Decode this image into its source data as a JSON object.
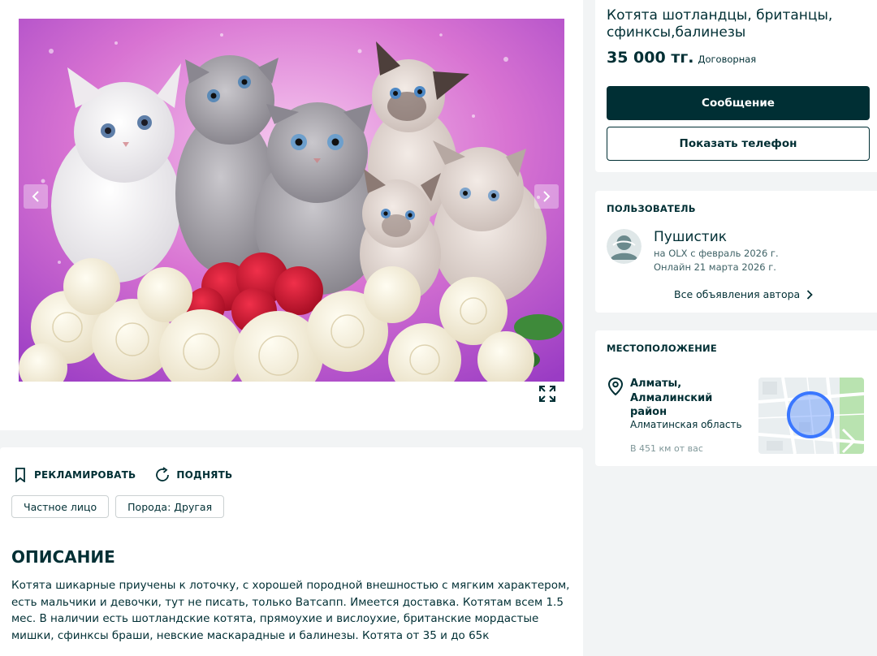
{
  "gallery": {
    "photo_alt": "",
    "prev_label": "",
    "next_label": ""
  },
  "actions": {
    "promote_label": "РЕКЛАМИРОВАТЬ",
    "raise_label": "ПОДНЯТЬ"
  },
  "tags": [
    "Частное лицо",
    "Порода: Другая"
  ],
  "description": {
    "title": "ОПИСАНИЕ",
    "text": "Котята шикарные приучены к лоточку, с хорошей породной внешностью с мягким характером, есть мальчики и девочки, тут не писать, только Ватсапп. Имеется доставка. Котятам всем 1.5 мес. В наличии есть шотландские котята, прямоухие и вислоухие, британские мордастые мишки, сфинксы браши, невские маскарадные и балинезы. Котята от 35 и до 65к"
  },
  "offer": {
    "title": "Котята шотландцы, британцы, сфинксы,балинезы",
    "price": "35 000 тг.",
    "negotiable": "Договорная",
    "message_button": "Сообщение",
    "phone_button": "Показать телефон"
  },
  "user": {
    "section_label": "ПОЛЬЗОВАТЕЛЬ",
    "name": "Пушистик",
    "since": "на OLX с февраль 2026 г.",
    "online": "Онлайн 21 марта 2026 г.",
    "all_ads": "Все объявления автора"
  },
  "location": {
    "section_label": "МЕСТОПОЛОЖЕНИЕ",
    "city": "Алматы, Алмалинский район",
    "region": "Алматинская область",
    "distance": "В 451 км от вас"
  },
  "colors": {
    "primary": "#002f34",
    "background": "#f2f4f5",
    "map_circle": "#3a77ff"
  }
}
